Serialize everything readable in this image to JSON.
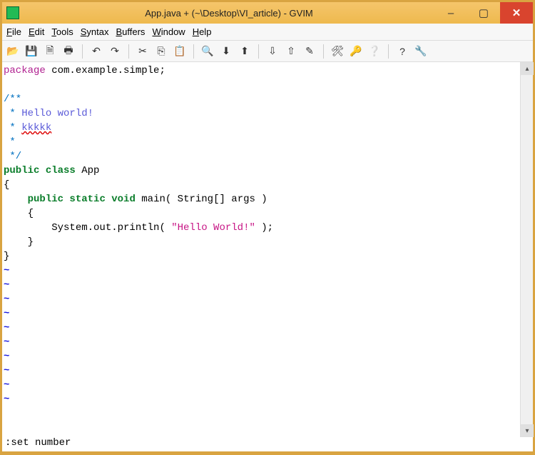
{
  "window": {
    "title": "App.java + (~\\Desktop\\VI_article) - GVIM",
    "buttons": {
      "min": "–",
      "max": "▢",
      "close": "✕"
    }
  },
  "menubar": {
    "file": "File",
    "edit": "Edit",
    "tools": "Tools",
    "syntax": "Syntax",
    "buffers": "Buffers",
    "window": "Window",
    "help": "Help"
  },
  "toolbar_icons": {
    "open": "📂",
    "save": "💾",
    "saveall": "🗎",
    "print": "🖶",
    "undo": "↶",
    "redo": "↷",
    "cut": "✂",
    "copy": "⎘",
    "paste": "📋",
    "find": "🔍",
    "findnext": "⬇",
    "findprev": "⬆",
    "session_load": "⇩",
    "session_save": "⇧",
    "script": "✎",
    "make": "🛠",
    "tags": "🔑",
    "help_ic": "❔",
    "qmark": "?",
    "wrench": "🔧"
  },
  "code": {
    "package_kw": "package",
    "package_name": " com.example.simple;",
    "doc_open": "/**",
    "star": " * ",
    "hello_cmt": "Hello world!",
    "spell": "kkkkk",
    "star_only": " *",
    "doc_close": " */",
    "public": "public",
    "class": " class",
    "appname": " App",
    "lbrace": "{",
    "indent1": "    ",
    "static": " static",
    "void": " void",
    "main": " main",
    "args": "( String[] args )",
    "lbrace2": "    {",
    "indent2": "        ",
    "sysout": "System.out.println( ",
    "hello_str": "\"Hello World!\"",
    "sysend": " );",
    "rbrace2": "    }",
    "rbrace": "}",
    "tilde": "~"
  },
  "command": ":set number"
}
